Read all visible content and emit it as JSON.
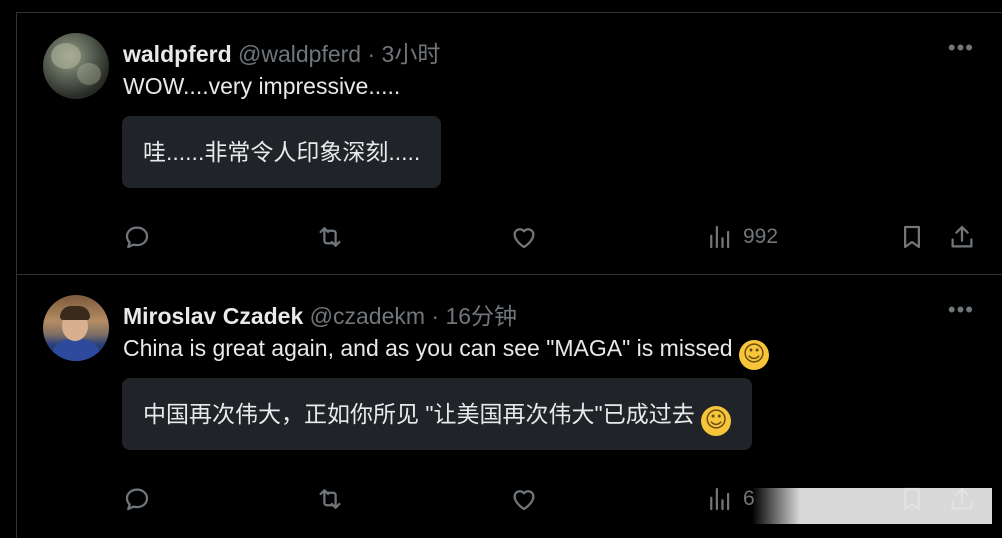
{
  "tweets": [
    {
      "author": {
        "name": "waldpferd",
        "handle": "@waldpferd",
        "time": "· 3小时"
      },
      "text": "WOW....very impressive.....",
      "translation": "哇......非常令人印象深刻.....",
      "stats": {
        "views": "992"
      }
    },
    {
      "author": {
        "name": "Miroslav Czadek",
        "handle": "@czadekm",
        "time": "· 16分钟"
      },
      "text": "China is great again, and as you can see  \"MAGA\" is missed",
      "translation": "中国再次伟大，正如你所见 \"让美国再次伟大\"已成过去",
      "stats": {
        "views": "6"
      }
    }
  ],
  "icons": {
    "more": "more-dots-icon",
    "reply": "reply-icon",
    "retweet": "retweet-icon",
    "like": "heart-icon",
    "views": "views-bar-chart-icon",
    "bookmark": "bookmark-icon",
    "share": "share-icon",
    "emoji": "smiling-face-emoji"
  },
  "colors": {
    "background": "#000000",
    "text": "#e7e9ea",
    "muted": "#71767b",
    "translation_bg": "#202327",
    "divider": "#2f3336"
  }
}
